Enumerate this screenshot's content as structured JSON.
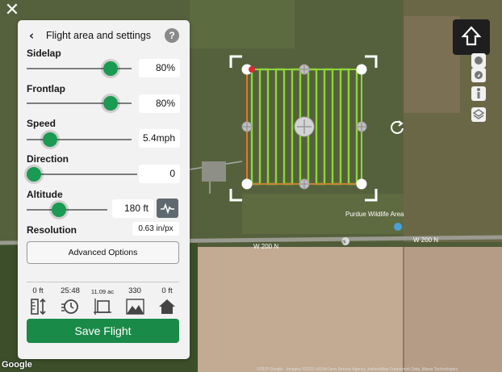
{
  "panel": {
    "title": "Flight area and settings",
    "back_icon": "chevron-left-icon",
    "help_icon": "question-mark-icon",
    "sidelap": {
      "label": "Sidelap",
      "value": "80%",
      "level": 80
    },
    "frontlap": {
      "label": "Frontlap",
      "value": "80%",
      "level": 80
    },
    "speed": {
      "label": "Speed",
      "value": "5.4mph",
      "level": 22
    },
    "direction": {
      "label": "Direction",
      "value": "0",
      "level": 0
    },
    "altitude": {
      "label": "Altitude",
      "value": "180 ft",
      "level": 40,
      "elevation_icon": "terrain-wave-icon"
    },
    "resolution": {
      "label": "Resolution",
      "value": "0.63 in/px"
    },
    "advanced_label": "Advanced Options",
    "stats": [
      {
        "value": "0 ft",
        "icon": "height-ruler-icon"
      },
      {
        "value": "25:48",
        "icon": "flight-time-icon"
      },
      {
        "value": "11.09 ac",
        "icon": "area-icon"
      },
      {
        "value": "330",
        "icon": "photos-icon"
      },
      {
        "value": "0 ft",
        "icon": "home-icon"
      }
    ],
    "save_label": "Save Flight"
  },
  "map": {
    "labels": {
      "wildlife": "Purdue Wildlife Area",
      "road1": "W 200 N",
      "road2": "W 200 N",
      "road_marker": "26"
    },
    "google": "Google",
    "credit": "©2023 Google · Imagery ©2023 USDA Farm Service Agency, IndianaMap Framework Data, Maxar Technologies"
  },
  "controls": {
    "close_icon": "close-icon",
    "home_icon": "home-arrow-up-icon",
    "rotate_icon": "rotate-icon",
    "side_icons": [
      "compass-icon",
      "navigation-icon",
      "pedestrian-icon",
      "layers-icon"
    ]
  },
  "colors": {
    "accent": "#1a9a52",
    "save": "#1a8a48",
    "grid": "#8fd63a",
    "path_start": "#e5782a"
  }
}
